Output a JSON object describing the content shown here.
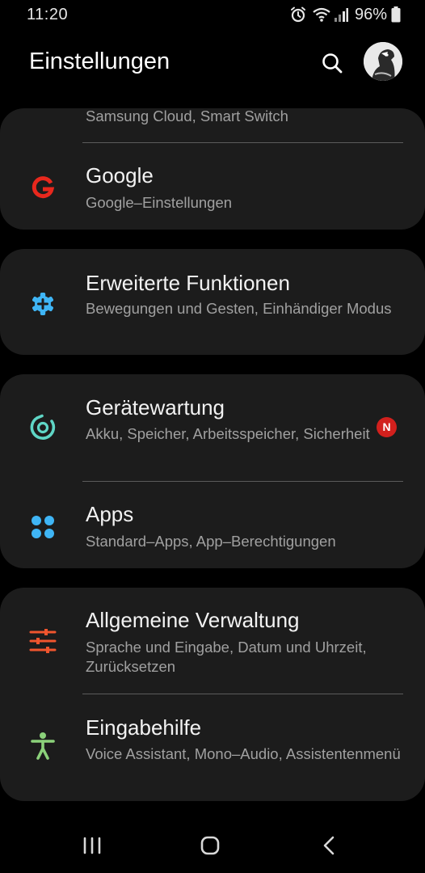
{
  "status_bar": {
    "time": "11:20",
    "battery": "96%",
    "icons": [
      "alarm-icon",
      "wifi-icon",
      "signal-icon",
      "battery-icon"
    ]
  },
  "header": {
    "title": "Einstellungen",
    "search_icon": "search-icon",
    "avatar": "profile-avatar"
  },
  "cards": [
    {
      "items": [
        {
          "title": "",
          "subtitle": "Samsung Cloud, Smart Switch",
          "icon": "cloud-icon"
        },
        {
          "title": "Google",
          "subtitle": "Google–Einstellungen",
          "icon": "google-icon",
          "color": "#e8281d"
        }
      ]
    },
    {
      "items": [
        {
          "title": "Erweiterte Funktionen",
          "subtitle": "Bewegungen und Gesten, Einhändiger Modus",
          "icon": "gear-plus-icon",
          "color": "#3fb5f5"
        }
      ]
    },
    {
      "items": [
        {
          "title": "Gerätewartung",
          "subtitle": "Akku, Speicher, Arbeitsspeicher, Sicherheit",
          "icon": "device-care-icon",
          "color": "#5fd6c6",
          "badge": "N"
        },
        {
          "title": "Apps",
          "subtitle": "Standard–Apps, App–Berechtigungen",
          "icon": "apps-icon",
          "color": "#3fb5f5"
        }
      ]
    },
    {
      "items": [
        {
          "title": "Allgemeine Verwaltung",
          "subtitle": "Sprache und Eingabe, Datum und Uhrzeit, Zurücksetzen",
          "icon": "sliders-icon",
          "color": "#f0552e"
        },
        {
          "title": "Eingabehilfe",
          "subtitle": "Voice Assistant, Mono–Audio, Assistentenmenü",
          "icon": "accessibility-icon",
          "color": "#8bd17a"
        }
      ]
    }
  ],
  "nav_bar": {
    "buttons": [
      "recents-icon",
      "home-icon",
      "back-icon"
    ]
  },
  "colors": {
    "background": "#000000",
    "card": "#1c1c1c",
    "badge": "#d2201d"
  }
}
